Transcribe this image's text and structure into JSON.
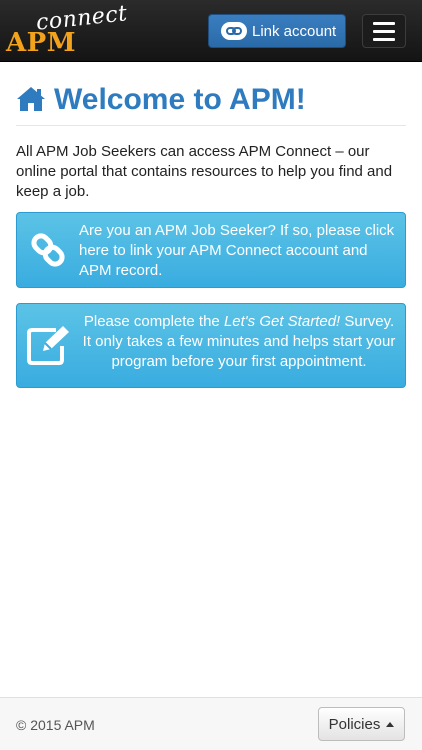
{
  "app": {
    "logo_top": "connect",
    "logo_main": "APM"
  },
  "navbar": {
    "link_account_label": "Link account",
    "link_icon": "link-icon",
    "menu_icon": "hamburger-icon"
  },
  "header": {
    "icon": "home-icon",
    "title": "Welcome to APM!"
  },
  "intro_text": "All APM Job Seekers can access APM Connect – our online portal that contains resources to help you find and keep a job.",
  "alerts": [
    {
      "icon": "link-icon",
      "text": "Are you an APM Job Seeker? If so, please click here to link your APM Connect account and APM record."
    },
    {
      "icon": "edit-icon",
      "text_before": "Please complete the ",
      "text_emphasis": "Let's Get Started!",
      "text_after": " Survey. It only takes a few minutes and helps start your program before your first appointment."
    }
  ],
  "footer": {
    "copyright": "© 2015 APM",
    "policies_label": "Policies"
  },
  "colors": {
    "brand_blue": "#2e7bbf",
    "info_blue": "#39ace0",
    "logo_orange": "#f3a21c",
    "navbar_dark": "#1c1c1c"
  }
}
